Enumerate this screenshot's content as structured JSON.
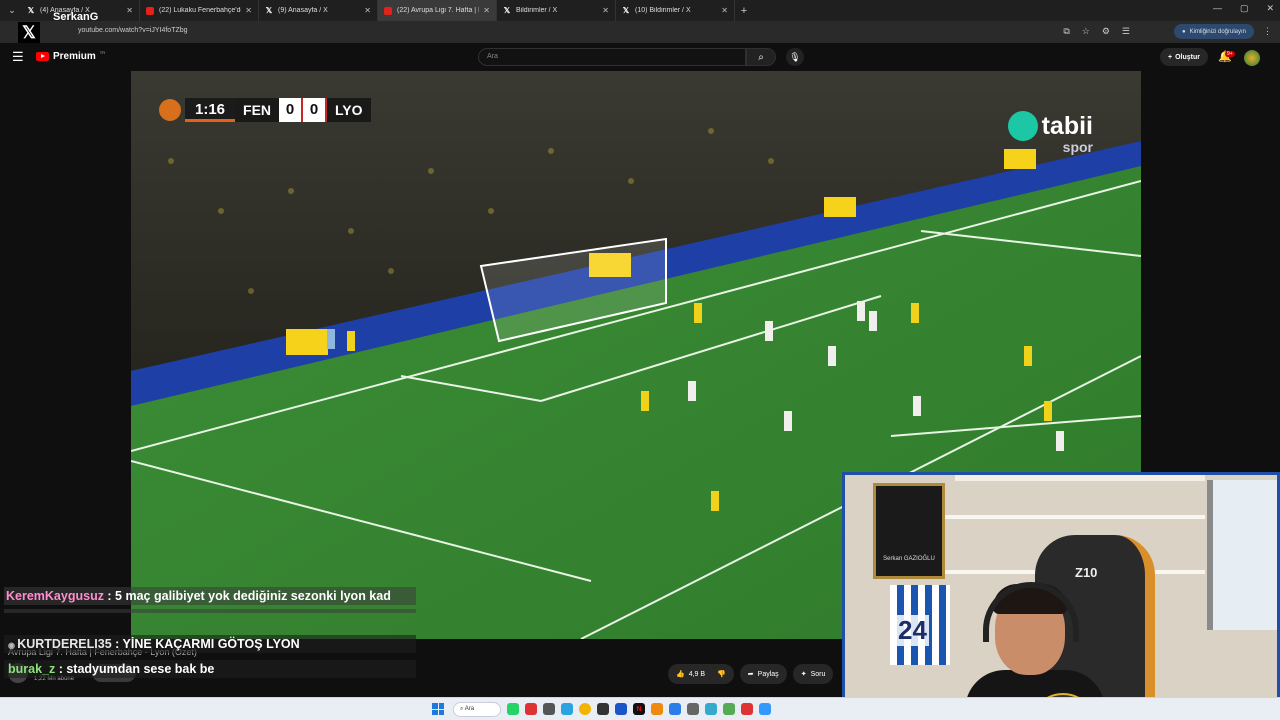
{
  "browser": {
    "tabs": [
      {
        "title": "(4) Anasayfa / X",
        "favicon": "x-icon",
        "active": false
      },
      {
        "title": "(22) Lukaku Fenerbahçe'de Na",
        "favicon": "youtube-icon",
        "active": false
      },
      {
        "title": "(9) Anasayfa / X",
        "favicon": "x-icon",
        "active": false
      },
      {
        "title": "(22) Avrupa Ligi 7. Hafta | F",
        "favicon": "youtube-icon",
        "active": true
      },
      {
        "title": "Bildirimler / X",
        "favicon": "x-icon",
        "active": false
      },
      {
        "title": "(10) Bildirimler / X",
        "favicon": "x-icon",
        "active": false
      }
    ],
    "url": "youtube.com/watch?v=iJYI4foTZbg",
    "verify_label": "Kimliğinizi doğrulayın"
  },
  "streamer_name": "SerkanG",
  "youtube": {
    "logo_text": "Premium",
    "country_code": "TR",
    "search_placeholder": "Ara",
    "create_label": "Oluştur",
    "notification_count": "9+"
  },
  "video": {
    "scoreboard": {
      "time": "1:16",
      "home": "FEN",
      "home_score": "0",
      "away_score": "0",
      "away": "LYO"
    },
    "broadcaster": "tabii",
    "broadcaster_sub": "spor",
    "title": "Avrupa Ligi 7. Hafta | Fenerbahçe - Lyon (Özet)",
    "subscribers": "1,22 Mn abone",
    "likes": "4,9 B",
    "share_label": "Paylaş",
    "ask_label": "Soru"
  },
  "chat": [
    {
      "user": "KeremKaygusuz",
      "message": " : 5 maç galibiyet yok dediğiniz sezonki lyon kad",
      "message_cont": "adamlar real juventus falan yaptı"
    },
    {
      "user": "KURTDERELI35",
      "message": " : YİNE KAÇARMI GÖTOŞ LYON"
    },
    {
      "user": "burak_z",
      "message": " : stadyumdan sese bak be"
    }
  ],
  "webcam": {
    "frame_name": "Serkan GAZIOĞLU",
    "jersey_number": "24",
    "chair_brand": "Z10"
  },
  "taskbar": {
    "search_label": "Ara"
  },
  "colors": {
    "youtube_red": "#ff0000",
    "webcam_border": "#1f4fa8",
    "pitch_green": "#2e7a2e",
    "chat_user_1": "#ff8ecf",
    "chat_user_3": "#8ae27b"
  }
}
